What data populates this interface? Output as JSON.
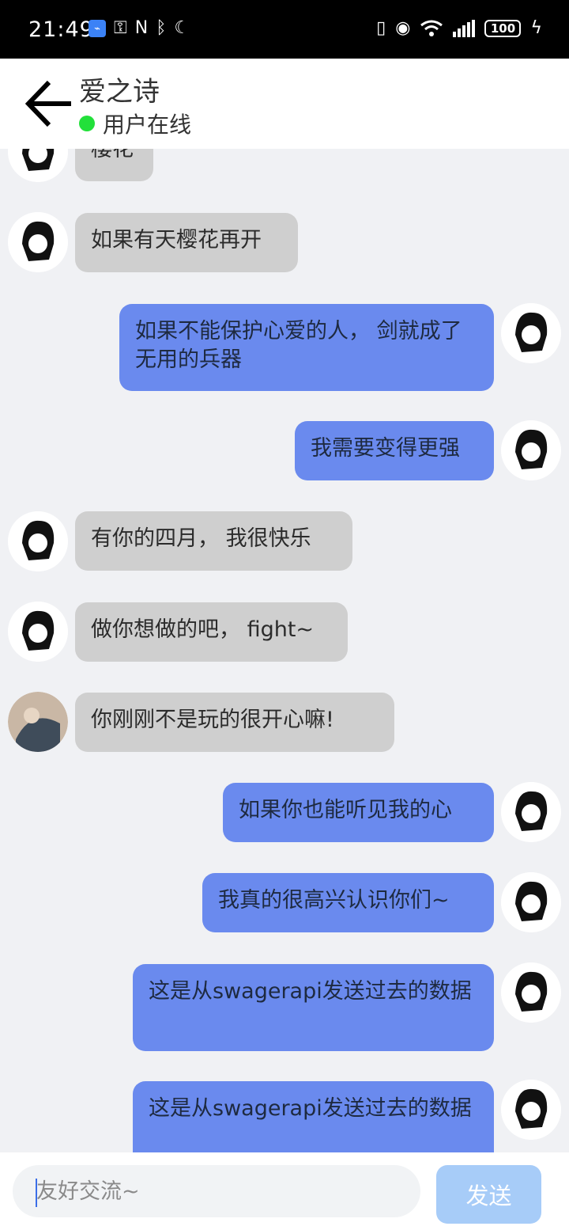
{
  "status_bar": {
    "time": "21:49",
    "battery": "100"
  },
  "header": {
    "title": "爱之诗",
    "status": "用户在线"
  },
  "messages": [
    {
      "side": "in",
      "text": "樱花"
    },
    {
      "side": "in",
      "text": "如果有天樱花再开"
    },
    {
      "side": "out",
      "text": "如果不能保护心爱的人， 剑就成了无用的兵器"
    },
    {
      "side": "out",
      "text": "我需要变得更强"
    },
    {
      "side": "in",
      "text": "有你的四月， 我很快乐"
    },
    {
      "side": "in",
      "text": "做你想做的吧， fight~"
    },
    {
      "side": "in",
      "text": "你刚刚不是玩的很开心嘛!"
    },
    {
      "side": "out",
      "text": "如果你也能听见我的心"
    },
    {
      "side": "out",
      "text": "我真的很高兴认识你们~"
    },
    {
      "side": "out",
      "text": "这是从swagerapi发送过去的数据"
    },
    {
      "side": "out",
      "text": "这是从swagerapi发送过去的数据"
    }
  ],
  "input": {
    "placeholder": "友好交流~",
    "value": ""
  },
  "send_label": "发送"
}
